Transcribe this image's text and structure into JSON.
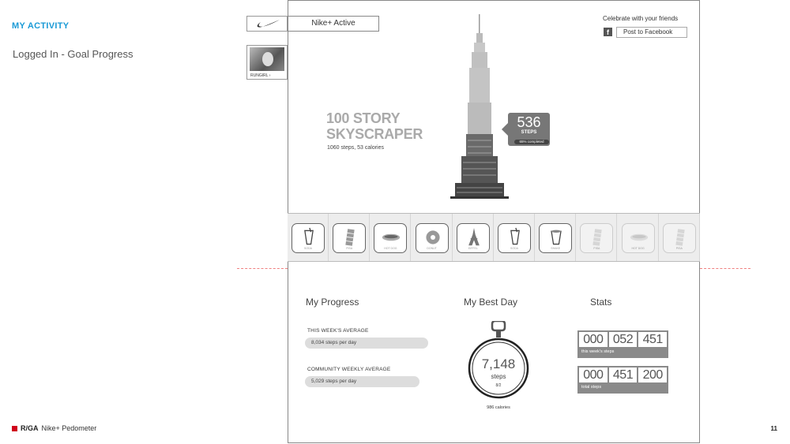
{
  "annotation": {
    "section_title": "MY ACTIVITY",
    "section_subtitle": "Logged In - Goal Progress",
    "footer_brand": "R/GA",
    "footer_product": "Nike+ Pedometer",
    "page_number": "11"
  },
  "sidebar": {
    "profile_name": "RUNGIRL ›"
  },
  "header": {
    "app_title": "Nike+ Active",
    "celebrate_text": "Celebrate with your friends",
    "facebook_icon": "f",
    "facebook_button": "Post to Facebook"
  },
  "goal": {
    "title_line1": "100 STORY",
    "title_line2": "SKYSCRAPER",
    "detail": "1060 steps, 53 calories",
    "steps": "536",
    "steps_label": "STEPS",
    "percent_completed": "65% completed"
  },
  "achievements": [
    {
      "icon": "drink-cup-icon",
      "label": "SODA",
      "unlocked": true
    },
    {
      "icon": "leaning-tower-icon",
      "label": "PISA",
      "unlocked": true
    },
    {
      "icon": "hotdog-icon",
      "label": "HOT DOG",
      "unlocked": true
    },
    {
      "icon": "donut-icon",
      "label": "DONUT",
      "unlocked": true
    },
    {
      "icon": "eiffel-tower-icon",
      "label": "EIFFEL",
      "unlocked": true
    },
    {
      "icon": "drink-cup-icon",
      "label": "SODA",
      "unlocked": true
    },
    {
      "icon": "milkshake-icon",
      "label": "SHAKE",
      "unlocked": true
    },
    {
      "icon": "leaning-tower-icon",
      "label": "PISA",
      "unlocked": false
    },
    {
      "icon": "hotdog-icon",
      "label": "HOT DOG",
      "unlocked": false
    },
    {
      "icon": "leaning-tower-icon",
      "label": "PISA",
      "unlocked": false
    }
  ],
  "progress": {
    "title": "My Progress",
    "week_label": "THIS WEEK'S AVERAGE",
    "week_value": "8,034 steps per day",
    "community_label": "COMMUNITY WEEKLY AVERAGE",
    "community_value": "5,029 steps per day"
  },
  "best_day": {
    "title": "My Best Day",
    "steps": "7,148",
    "unit": "steps",
    "date": "8/2",
    "calories": "986 calories"
  },
  "stats": {
    "title": "Stats",
    "week_digits": [
      "000",
      "052",
      "451"
    ],
    "week_caption": "this week's steps",
    "total_digits": [
      "000",
      "451",
      "200"
    ],
    "total_caption": "total steps"
  },
  "colors": {
    "accent": "#1a9ad6",
    "brand_red": "#d0021b"
  }
}
